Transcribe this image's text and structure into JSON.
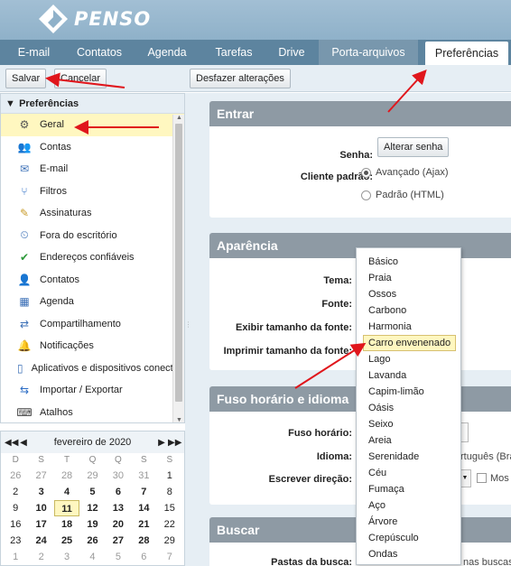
{
  "app": {
    "logo_text": "PENSO"
  },
  "tabs": [
    {
      "label": "E-mail",
      "width": 75,
      "state": "normal"
    },
    {
      "label": "Contatos",
      "width": 70,
      "state": "normal"
    },
    {
      "label": "Agenda",
      "width": 80,
      "state": "normal"
    },
    {
      "label": "Tarefas",
      "width": 68,
      "state": "normal"
    },
    {
      "label": "Drive",
      "width": 60,
      "state": "normal"
    },
    {
      "label": "Porta-arquivos",
      "width": 110,
      "state": "muted"
    },
    {
      "label": "Preferências",
      "width": 92,
      "state": "active"
    }
  ],
  "toolbar": {
    "save": "Salvar",
    "cancel": "Cancelar",
    "undo": "Desfazer alterações"
  },
  "sidebar": {
    "header": "Preferências",
    "items": [
      {
        "label": "Geral",
        "icon": "gear-icon"
      },
      {
        "label": "Contas",
        "icon": "accounts-icon"
      },
      {
        "label": "E-mail",
        "icon": "mail-icon"
      },
      {
        "label": "Filtros",
        "icon": "filter-icon"
      },
      {
        "label": "Assinaturas",
        "icon": "signature-icon"
      },
      {
        "label": "Fora do escritório",
        "icon": "out-of-office-icon"
      },
      {
        "label": "Endereços confiáveis",
        "icon": "shield-check-icon"
      },
      {
        "label": "Contatos",
        "icon": "contacts-icon"
      },
      {
        "label": "Agenda",
        "icon": "calendar-icon"
      },
      {
        "label": "Compartilhamento",
        "icon": "share-icon"
      },
      {
        "label": "Notificações",
        "icon": "bell-icon"
      },
      {
        "label": "Aplicativos e dispositivos conectados",
        "icon": "mobile-icon"
      },
      {
        "label": "Importar / Exportar",
        "icon": "import-export-icon"
      },
      {
        "label": "Atalhos",
        "icon": "keyboard-icon"
      }
    ]
  },
  "calendar": {
    "month": "fevereiro de 2020",
    "weekdays": [
      "D",
      "S",
      "T",
      "Q",
      "Q",
      "S",
      "S"
    ],
    "weeks": [
      [
        "26",
        "27",
        "28",
        "29",
        "30",
        "31",
        "1"
      ],
      [
        "2",
        "3",
        "4",
        "5",
        "6",
        "7",
        "8"
      ],
      [
        "9",
        "10",
        "11",
        "12",
        "13",
        "14",
        "15"
      ],
      [
        "16",
        "17",
        "18",
        "19",
        "20",
        "21",
        "22"
      ],
      [
        "23",
        "24",
        "25",
        "26",
        "27",
        "28",
        "29"
      ],
      [
        "1",
        "2",
        "3",
        "4",
        "5",
        "6",
        "7"
      ]
    ],
    "today": "11"
  },
  "sections": {
    "entrar": {
      "title": "Entrar",
      "senha_label": "Senha:",
      "change_password": "Alterar senha",
      "client_label": "Cliente padrão:",
      "advanced": "Avançado (Ajax)",
      "standard": "Padrão (HTML)"
    },
    "aparencia": {
      "title": "Aparência",
      "tema_label": "Tema:",
      "fonte_label": "Fonte:",
      "exibir_label": "Exibir tamanho da fonte:",
      "imprimir_label": "Imprimir tamanho da fonte:"
    },
    "fuso": {
      "title": "Fuso horário e idioma",
      "fuso_label": "Fuso horário:",
      "idioma_label": "Idioma:",
      "idioma_partial": "rtuguês (Bra",
      "direcao_label": "Escrever direção:",
      "mostrar_partial": "Mos"
    },
    "buscar": {
      "title": "Buscar",
      "pastas_label": "Pastas da busca:",
      "pastas_partial": "nas buscas"
    }
  },
  "theme_options": [
    "Básico",
    "Praia",
    "Ossos",
    "Carbono",
    "Harmonia",
    "Carro envenenado",
    "Lago",
    "Lavanda",
    "Capim-limão",
    "Oásis",
    "Seixo",
    "Areia",
    "Serenidade",
    "Céu",
    "Fumaça",
    "Aço",
    "Árvore",
    "Crepúsculo",
    "Ondas"
  ],
  "theme_highlighted": "Carro envenenado",
  "colors": {
    "tabbar": "#5d849f",
    "header": "#97b7cd",
    "highlight": "#fff7c0",
    "arrow": "#e0161c"
  }
}
